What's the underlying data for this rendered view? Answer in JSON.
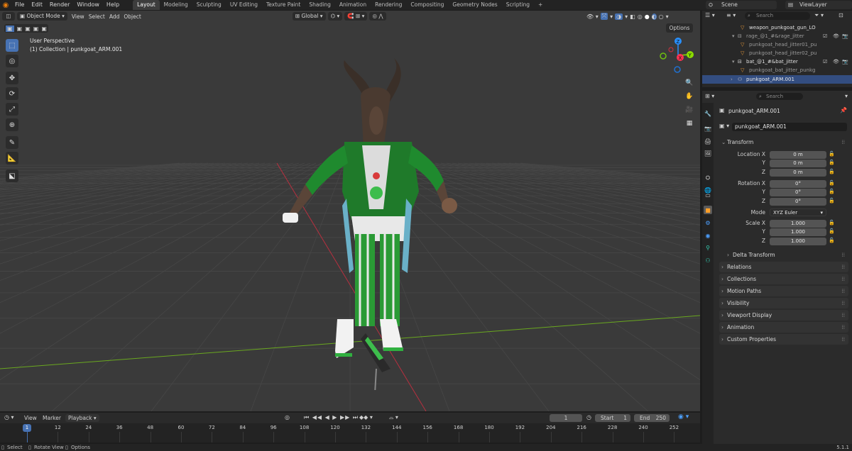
{
  "menu": [
    "File",
    "Edit",
    "Render",
    "Window",
    "Help"
  ],
  "workspaces": [
    "Layout",
    "Modeling",
    "Sculpting",
    "UV Editing",
    "Texture Paint",
    "Shading",
    "Animation",
    "Rendering",
    "Compositing",
    "Geometry Nodes",
    "Scripting"
  ],
  "add_tab": "+",
  "scene": {
    "label": "Scene",
    "viewlayer": "ViewLayer"
  },
  "viewport": {
    "mode": "Object Mode",
    "menus": [
      "View",
      "Select",
      "Add",
      "Object"
    ],
    "orientation": "Global",
    "options": "Options",
    "info_line1": "User Perspective",
    "info_line2": "(1) Collection | punkgoat_ARM.001",
    "gizmo": {
      "z": "Z",
      "y": "Y",
      "x": "X"
    }
  },
  "outliner": {
    "search_placeholder": "Search",
    "rows": [
      "weapon_punkgoat_gun_LO",
      "rage_@1_#&rage_jitter",
      "punkgoat_head_jitter01_pu",
      "punkgoat_head_jitter02_pu",
      "bat_@1_#&bat_jitter",
      "punkgoat_bat_jitter_punkg",
      "punkgoat_ARM.001"
    ]
  },
  "properties": {
    "search_placeholder": "Search",
    "object_name": "punkgoat_ARM.001",
    "object_field": "punkgoat_ARM.001",
    "transform_title": "Transform",
    "location_labels": [
      "Location X",
      "Y",
      "Z"
    ],
    "location_values": [
      "0 m",
      "0 m",
      "0 m"
    ],
    "rotation_labels": [
      "Rotation X",
      "Y",
      "Z"
    ],
    "rotation_values": [
      "0°",
      "0°",
      "0°"
    ],
    "mode_label": "Mode",
    "mode_value": "XYZ Euler",
    "scale_labels": [
      "Scale X",
      "Y",
      "Z"
    ],
    "scale_values": [
      "1.000",
      "1.000",
      "1.000"
    ],
    "delta_transform": "Delta Transform",
    "panels": [
      "Relations",
      "Collections",
      "Motion Paths",
      "Visibility",
      "Viewport Display",
      "Animation",
      "Custom Properties"
    ]
  },
  "timeline": {
    "menus": [
      "View",
      "Marker",
      "Playback"
    ],
    "current_frame": "1",
    "start_label": "Start",
    "start": "1",
    "end_label": "End",
    "end": "250",
    "ticks": [
      "1",
      "12",
      "24",
      "36",
      "48",
      "60",
      "72",
      "84",
      "96",
      "108",
      "120",
      "132",
      "144",
      "156",
      "168",
      "180",
      "192",
      "204",
      "216",
      "228",
      "240",
      "252"
    ]
  },
  "status": {
    "select": "Select",
    "rotate": "Rotate View",
    "options": "Options",
    "version": "5.1.1"
  },
  "colors": {
    "accent": "#4772b3",
    "x_axis": "#ff3352",
    "y_axis": "#8bdc00",
    "z_axis": "#2890ff",
    "active_obj": "#ffa028"
  }
}
